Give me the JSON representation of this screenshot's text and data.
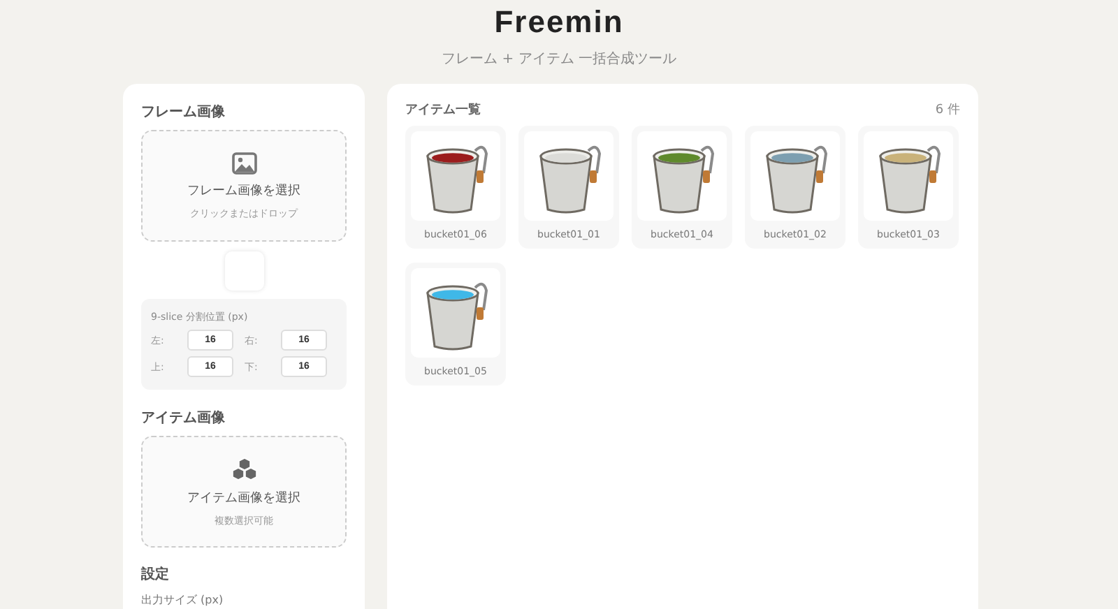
{
  "header": {
    "title": "Freemin",
    "subtitle": "フレーム + アイテム 一括合成ツール"
  },
  "sidebar": {
    "frame_section": {
      "heading": "フレーム画像",
      "dropzone": {
        "label": "フレーム画像を選択",
        "hint": "クリックまたはドロップ"
      },
      "slice": {
        "heading": "9-slice 分割位置 (px)",
        "fields": [
          {
            "label": "左:",
            "value": "16"
          },
          {
            "label": "右:",
            "value": "16"
          },
          {
            "label": "上:",
            "value": "16"
          },
          {
            "label": "下:",
            "value": "16"
          }
        ]
      }
    },
    "item_section": {
      "heading": "アイテム画像",
      "dropzone": {
        "label": "アイテム画像を選択",
        "hint": "複数選択可能"
      }
    },
    "settings": {
      "heading": "設定",
      "output_size_label": "出力サイズ (px)"
    }
  },
  "items_panel": {
    "heading": "アイテム一覧",
    "count": "6 件",
    "items": [
      {
        "name": "bucket01_06",
        "color": "#9b1c1c"
      },
      {
        "name": "bucket01_01",
        "color": "#dcdcd8"
      },
      {
        "name": "bucket01_04",
        "color": "#5f8a2c"
      },
      {
        "name": "bucket01_02",
        "color": "#7d9fb0"
      },
      {
        "name": "bucket01_03",
        "color": "#c9b27a"
      },
      {
        "name": "bucket01_05",
        "color": "#3fb8e8"
      }
    ]
  }
}
